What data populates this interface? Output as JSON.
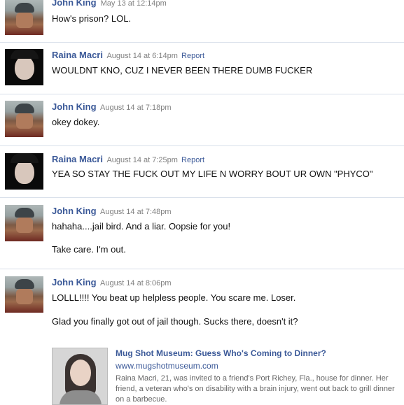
{
  "messages": [
    {
      "author": "John King",
      "time": "May 13 at 12:14pm",
      "report": "",
      "lines": [
        "How's prison? LOL."
      ]
    },
    {
      "author": "Raina Macri",
      "time": "August 14 at 6:14pm",
      "report": "Report",
      "lines": [
        "WOULDNT KNO, CUZ I NEVER BEEN THERE DUMB FUCKER"
      ]
    },
    {
      "author": "John King",
      "time": "August 14 at 7:18pm",
      "report": "",
      "lines": [
        "okey dokey."
      ]
    },
    {
      "author": "Raina Macri",
      "time": "August 14 at 7:25pm",
      "report": "Report",
      "lines": [
        "YEA SO STAY THE FUCK OUT MY LIFE N WORRY BOUT UR OWN \"PHYCO\""
      ]
    },
    {
      "author": "John King",
      "time": "August 14 at 7:48pm",
      "report": "",
      "lines": [
        "hahaha....jail bird. And a liar. Oopsie for you!",
        "Take care. I'm out."
      ]
    },
    {
      "author": "John King",
      "time": "August 14 at 8:06pm",
      "report": "",
      "lines": [
        "LOLLL!!!! You beat up helpless people. You scare me. Loser.",
        "Glad you finally got out of jail though. Sucks there, doesn't it?"
      ]
    }
  ],
  "link_card": {
    "title": "Mug Shot Museum: Guess Who's Coming to Dinner?",
    "url": "www.mugshotmuseum.com",
    "description": "Raina Macri, 21, was invited to a friend's Port Richey, Fla., house for dinner. Her friend, a veteran who's on disability with a brain injury, went out back to grill dinner on a barbecue."
  },
  "colors": {
    "link_blue": "#3b5998",
    "divider": "#d8dfea"
  }
}
